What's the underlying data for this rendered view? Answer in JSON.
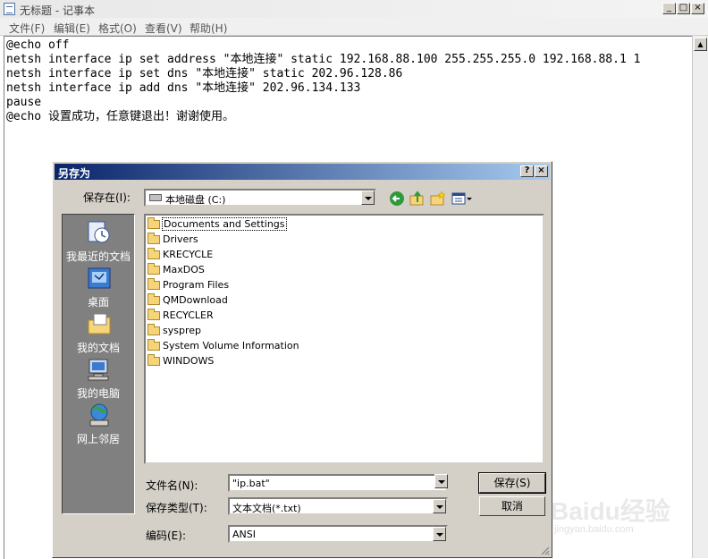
{
  "notepad": {
    "title": "无标题 - 记事本",
    "menu": [
      "文件(F)",
      "编辑(E)",
      "格式(O)",
      "查看(V)",
      "帮助(H)"
    ],
    "lines": [
      "@echo off",
      "netsh interface ip set address \"本地连接\" static 192.168.88.100 255.255.255.0 192.168.88.1 1",
      "netsh interface ip set dns \"本地连接\" static 202.96.128.86",
      "netsh interface ip add dns \"本地连接\" 202.96.134.133",
      "pause",
      "@echo 设置成功，任意键退出！谢谢使用。"
    ]
  },
  "dialog": {
    "title": "另存为",
    "save_in_label": "保存在(I):",
    "save_in_value": "本地磁盘 (C:)",
    "places": [
      {
        "label": "我最近的文档",
        "icon": "recent-documents-icon"
      },
      {
        "label": "桌面",
        "icon": "desktop-icon"
      },
      {
        "label": "我的文档",
        "icon": "my-documents-icon"
      },
      {
        "label": "我的电脑",
        "icon": "my-computer-icon"
      },
      {
        "label": "网上邻居",
        "icon": "network-places-icon"
      }
    ],
    "files": [
      "Documents and Settings",
      "Drivers",
      "KRECYCLE",
      "MaxDOS",
      "Program Files",
      "QMDownload",
      "RECYCLER",
      "sysprep",
      "System Volume Information",
      "WINDOWS"
    ],
    "filename_label": "文件名(N):",
    "filename_value": "\"ip.bat\"",
    "filetype_label": "保存类型(T):",
    "filetype_value": "文本文档(*.txt)",
    "encoding_label": "编码(E):",
    "encoding_value": "ANSI",
    "save_button": "保存(S)",
    "cancel_button": "取消"
  },
  "watermark": {
    "logo": "Baidu经验",
    "url": "jingyan.baidu.com"
  }
}
